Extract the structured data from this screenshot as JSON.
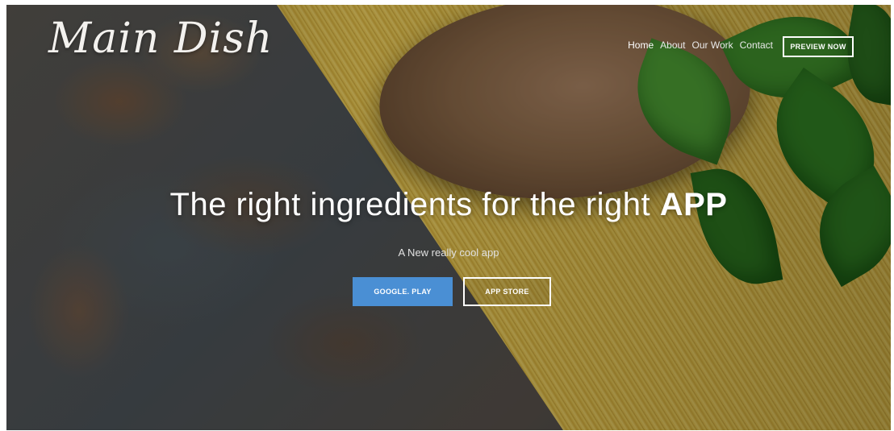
{
  "brand": {
    "logo_text": "Main Dish"
  },
  "nav": {
    "items": [
      {
        "label": "Home",
        "active": true
      },
      {
        "label": "About",
        "active": false
      },
      {
        "label": "Our Work",
        "active": false
      },
      {
        "label": "Contact",
        "active": false
      }
    ],
    "cta_label": "PREVIEW NOW"
  },
  "hero": {
    "title_prefix": "The right ingredients for the right ",
    "title_emphasis": "APP",
    "subtitle": "A New really cool app",
    "buttons": {
      "google_play": "GOOGLE. PLAY",
      "app_store": "APP STORE"
    }
  },
  "colors": {
    "accent": "#4a8fd4",
    "text": "#ffffff"
  }
}
